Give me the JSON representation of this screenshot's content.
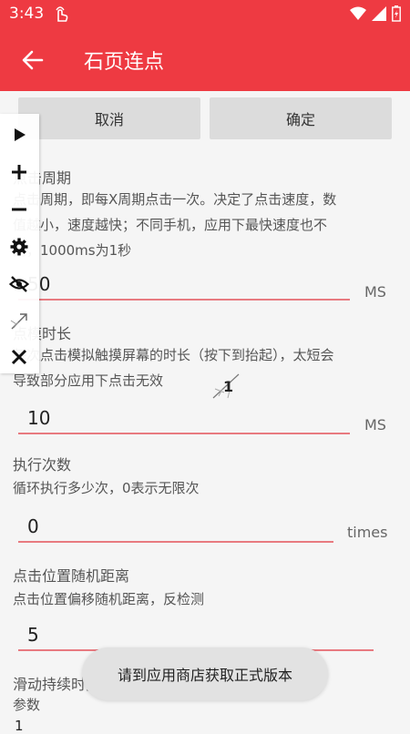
{
  "status_bar": {
    "time": "3:43"
  },
  "app_bar": {
    "title": "石页连点"
  },
  "buttons": {
    "cancel": "取消",
    "confirm": "确定"
  },
  "sections": [
    {
      "title": "点击周期",
      "desc_lines": [
        "点击周期，即每X周期点击一次。决定了点击速度，数",
        "值越小，速度越快；不同手机，应用下最快速度也不",
        "同，1000ms为1秒"
      ],
      "value": "50",
      "unit": "MS"
    },
    {
      "title": "点模时长",
      "desc_lines": [
        "每次点击模拟触摸屏幕的时长（按下到抬起），太短会",
        "导致部分应用下点击无效"
      ],
      "value": "10",
      "unit": "MS"
    },
    {
      "title": "执行次数",
      "desc_lines": [
        "循环执行多少次，0表示无限次"
      ],
      "value": "0",
      "unit": "times"
    },
    {
      "title": "点击位置随机距离",
      "desc_lines": [
        "点击位置偏移随机距离，反检测"
      ],
      "value": "5",
      "unit": ""
    },
    {
      "title": "滑动持续时间",
      "desc_lines": [
        "参数"
      ],
      "value": "1",
      "unit": ""
    }
  ],
  "target_marker": {
    "label": "1"
  },
  "toast": {
    "text": "请到应用商店获取正式版本"
  },
  "colors": {
    "accent": "#ee3a42",
    "underline": "#e87a80",
    "background": "#f5f5f5"
  },
  "floating_toolbar": [
    "play-icon",
    "plus-icon",
    "minus-icon",
    "gear-icon",
    "eye-off-icon",
    "target-icon",
    "close-icon"
  ]
}
